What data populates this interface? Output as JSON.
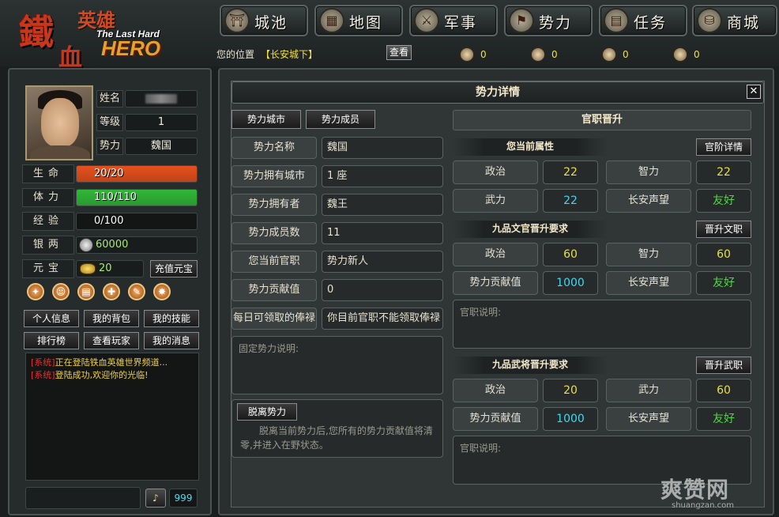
{
  "logo": {
    "mark": "鐵",
    "sub_mark": "血",
    "cn_title": "英雄",
    "en_line": "The Last Hard",
    "en_title": "HERO"
  },
  "nav": [
    {
      "label": "城池",
      "icon": "city-gate-icon",
      "glyph": "⛩"
    },
    {
      "label": "地图",
      "icon": "map-icon",
      "glyph": "▦"
    },
    {
      "label": "军事",
      "icon": "military-icon",
      "glyph": "⚔"
    },
    {
      "label": "势力",
      "icon": "faction-icon",
      "glyph": "⚑"
    },
    {
      "label": "任务",
      "icon": "quest-icon",
      "glyph": "▤"
    },
    {
      "label": "商城",
      "icon": "shop-icon",
      "glyph": "⛁"
    }
  ],
  "location": {
    "label": "您的位置",
    "value": "【长安城下】",
    "view_button": "查看"
  },
  "resources": [
    {
      "icon": "food-icon",
      "value": "0"
    },
    {
      "icon": "wood-icon",
      "value": "0"
    },
    {
      "icon": "stone-icon",
      "value": "0"
    },
    {
      "icon": "iron-icon",
      "value": "0"
    }
  ],
  "player": {
    "name_label": "姓名",
    "name_value": "",
    "level_label": "等级",
    "level_value": "1",
    "faction_label": "势力",
    "faction_value": "魏国",
    "hp_label": "生命",
    "hp_text": "20/20",
    "hp_ratio": 1.0,
    "stamina_label": "体力",
    "stamina_text": "110/110",
    "stamina_ratio": 1.0,
    "exp_label": "经验",
    "exp_text": "0/100",
    "exp_ratio": 0,
    "silver_label": "银两",
    "silver_value": "60000",
    "gold_label": "元宝",
    "gold_value": "20",
    "recharge_button": "充值元宝"
  },
  "skill_icons": [
    "gift-icon",
    "face-icon",
    "book-icon",
    "skill-icon",
    "scroll-icon",
    "fire-icon"
  ],
  "left_buttons": [
    [
      "个人信息",
      "我的背包",
      "我的技能"
    ],
    [
      "排行榜",
      "查看玩家",
      "我的消息"
    ]
  ],
  "messages": [
    {
      "tag": "[系统]",
      "text": "正在登陆铁血英雄世界频道..."
    },
    {
      "tag": "[系统]",
      "text": "登陆成功,欢迎你的光临!"
    }
  ],
  "chat": {
    "send_icon": "horn-icon",
    "count": "999"
  },
  "dialog": {
    "title": "势力详情",
    "close": "✕",
    "tabs": [
      "势力城市",
      "势力成员"
    ],
    "info_rows": [
      {
        "label": "势力名称",
        "value": "魏国"
      },
      {
        "label": "势力拥有城市",
        "value": "1 座"
      },
      {
        "label": "势力拥有者",
        "value": "魏王"
      },
      {
        "label": "势力成员数",
        "value": "11"
      },
      {
        "label": "您当前官职",
        "value": "势力新人"
      },
      {
        "label": "势力贡献值",
        "value": "0"
      },
      {
        "label": "每日可领取的俸禄",
        "value": "你目前官职不能领取俸禄"
      }
    ],
    "faction_desc_placeholder": "固定势力说明:",
    "leave_button": "脱离势力",
    "leave_note": "脱离当前势力后,您所有的势力贡献值将清零,并进入在野状态。",
    "promotion": {
      "title": "官职晋升",
      "current_attrs_title": "您当前属性",
      "rank_detail_button": "官阶详情",
      "current_attrs": [
        {
          "label": "政治",
          "value": "22",
          "color": "yellow"
        },
        {
          "label": "智力",
          "value": "22",
          "color": "yellow"
        },
        {
          "label": "武力",
          "value": "22",
          "color": "cyan"
        },
        {
          "label": "长安声望",
          "value": "友好",
          "color": "green"
        }
      ],
      "civil_title": "九品文官晋升要求",
      "civil_button": "晋升文职",
      "civil_reqs": [
        {
          "label": "政治",
          "value": "60",
          "color": "yellow"
        },
        {
          "label": "智力",
          "value": "60",
          "color": "yellow"
        },
        {
          "label": "势力贡献值",
          "value": "1000",
          "color": "cyan"
        },
        {
          "label": "长安声望",
          "value": "友好",
          "color": "green"
        }
      ],
      "civil_desc": "官职说明:",
      "military_title": "九品武将晋升要求",
      "military_button": "晋升武职",
      "military_reqs": [
        {
          "label": "政治",
          "value": "20",
          "color": "yellow"
        },
        {
          "label": "武力",
          "value": "60",
          "color": "yellow"
        },
        {
          "label": "势力贡献值",
          "value": "1000",
          "color": "cyan"
        },
        {
          "label": "长安声望",
          "value": "友好",
          "color": "green"
        }
      ],
      "military_desc": "官职说明:"
    }
  },
  "watermark": {
    "cn": "爽赞网",
    "url": "shuangzan.com"
  },
  "colors": {
    "hp": "#e8501c",
    "stamina": "#30b838",
    "exp": "#6a6a6a",
    "highlight": "#f0e040"
  }
}
